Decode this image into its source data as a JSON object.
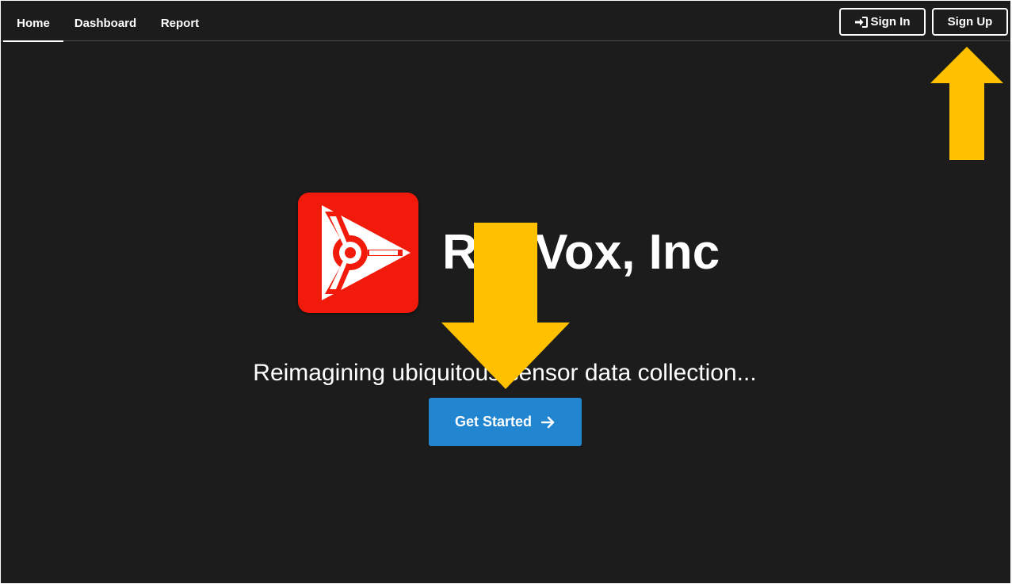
{
  "nav": {
    "tabs": [
      {
        "label": "Home",
        "active": true
      },
      {
        "label": "Dashboard",
        "active": false
      },
      {
        "label": "Report",
        "active": false
      }
    ],
    "sign_in_label": "Sign In",
    "sign_up_label": "Sign Up"
  },
  "hero": {
    "brand": "RedVox, Inc",
    "tagline": "Reimagining ubiquitous sensor data collection...",
    "cta_label": "Get Started"
  },
  "icons": {
    "sign_in": "sign-in-icon",
    "cta": "arrow-right-icon",
    "logo": "redvox-logo"
  },
  "colors": {
    "background": "#1c1c1c",
    "cta": "#2185d0",
    "logo": "#f21a0a",
    "annotation_arrow": "#ffc000"
  }
}
